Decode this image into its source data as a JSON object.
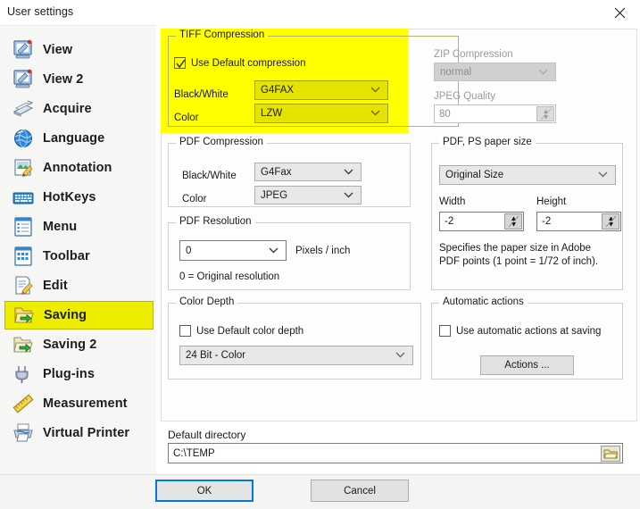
{
  "window": {
    "title": "User settings",
    "close_icon": "close-icon"
  },
  "sidebar": {
    "items": [
      {
        "label": "View",
        "icon": "monitor-edit-icon",
        "selected": false
      },
      {
        "label": "View 2",
        "icon": "monitor-edit-icon",
        "selected": false
      },
      {
        "label": "Acquire",
        "icon": "scanner-icon",
        "selected": false
      },
      {
        "label": "Language",
        "icon": "globe-icon",
        "selected": false
      },
      {
        "label": "Annotation",
        "icon": "annotation-icon",
        "selected": false
      },
      {
        "label": "HotKeys",
        "icon": "keyboard-icon",
        "selected": false
      },
      {
        "label": "Menu",
        "icon": "menu-list-icon",
        "selected": false
      },
      {
        "label": "Toolbar",
        "icon": "toolbar-grid-icon",
        "selected": false
      },
      {
        "label": "Edit",
        "icon": "edit-pencil-icon",
        "selected": false
      },
      {
        "label": "Saving",
        "icon": "save-folder-icon",
        "selected": true
      },
      {
        "label": "Saving 2",
        "icon": "save-folder-icon",
        "selected": false
      },
      {
        "label": "Plug-ins",
        "icon": "plug-icon",
        "selected": false
      },
      {
        "label": "Measurement",
        "icon": "ruler-icon",
        "selected": false
      },
      {
        "label": "Virtual Printer",
        "icon": "printer-icon",
        "selected": false
      }
    ]
  },
  "tiff_compression": {
    "title": "TIFF Compression",
    "use_default": {
      "label": "Use Default compression",
      "checked": true
    },
    "black_white": {
      "label": "Black/White",
      "value": "G4FAX"
    },
    "color": {
      "label": "Color",
      "value": "LZW"
    },
    "highlighted": true,
    "highlight_color": "#ffff00"
  },
  "zip_compression": {
    "label": "ZIP Compression",
    "value": "normal",
    "disabled": true,
    "jpeg_quality_label": "JPEG Quality",
    "jpeg_quality_value": "80"
  },
  "pdf_compression": {
    "title": "PDF Compression",
    "black_white": {
      "label": "Black/White",
      "value": "G4Fax"
    },
    "color": {
      "label": "Color",
      "value": "JPEG"
    }
  },
  "pdf_resolution": {
    "title": "PDF Resolution",
    "value": "0",
    "units": "Pixels / inch",
    "note": "0 = Original resolution"
  },
  "paper_size": {
    "title": "PDF, PS paper size",
    "size": "Original Size",
    "width_label": "Width",
    "width_value": "-2",
    "height_label": "Height",
    "height_value": "-2",
    "note": "Specifies the paper size in Adobe PDF points (1 point = 1/72 of inch)."
  },
  "color_depth": {
    "title": "Color Depth",
    "use_default": {
      "label": "Use Default color depth",
      "checked": false
    },
    "value": "24 Bit - Color"
  },
  "automatic_actions": {
    "title": "Automatic actions",
    "use_auto": {
      "label": "Use automatic actions at saving",
      "checked": false
    },
    "actions_button": "Actions ..."
  },
  "default_directory": {
    "label": "Default directory",
    "value": "C:\\TEMP",
    "browse_icon": "folder-icon"
  },
  "footer": {
    "ok": "OK",
    "cancel": "Cancel"
  }
}
